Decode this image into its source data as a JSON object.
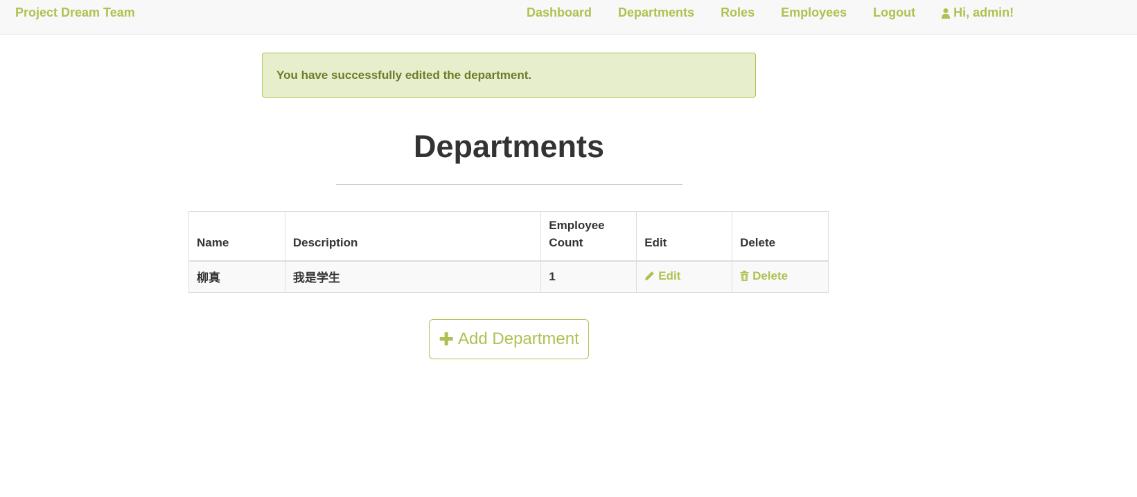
{
  "navbar": {
    "brand": "Project Dream Team",
    "links": {
      "dashboard": "Dashboard",
      "departments": "Departments",
      "roles": "Roles",
      "employees": "Employees",
      "logout": "Logout",
      "user": "Hi, admin!"
    }
  },
  "alert": {
    "message": "You have successfully edited the department."
  },
  "page": {
    "title": "Departments"
  },
  "table": {
    "headers": {
      "name": "Name",
      "description": "Description",
      "count": "Employee Count",
      "edit": "Edit",
      "delete": "Delete"
    },
    "rows": [
      {
        "name": "柳真",
        "description": "我是学生",
        "count": "1",
        "edit": "Edit",
        "delete": "Delete"
      }
    ]
  },
  "actions": {
    "add_department": "Add Department"
  },
  "colors": {
    "accent": "#aec251",
    "alert_bg": "#e6eecb",
    "alert_text": "#6a7d2b"
  },
  "icons": {
    "user": "user-icon",
    "edit": "pencil-icon",
    "delete": "trash-icon",
    "add": "plus-icon"
  }
}
